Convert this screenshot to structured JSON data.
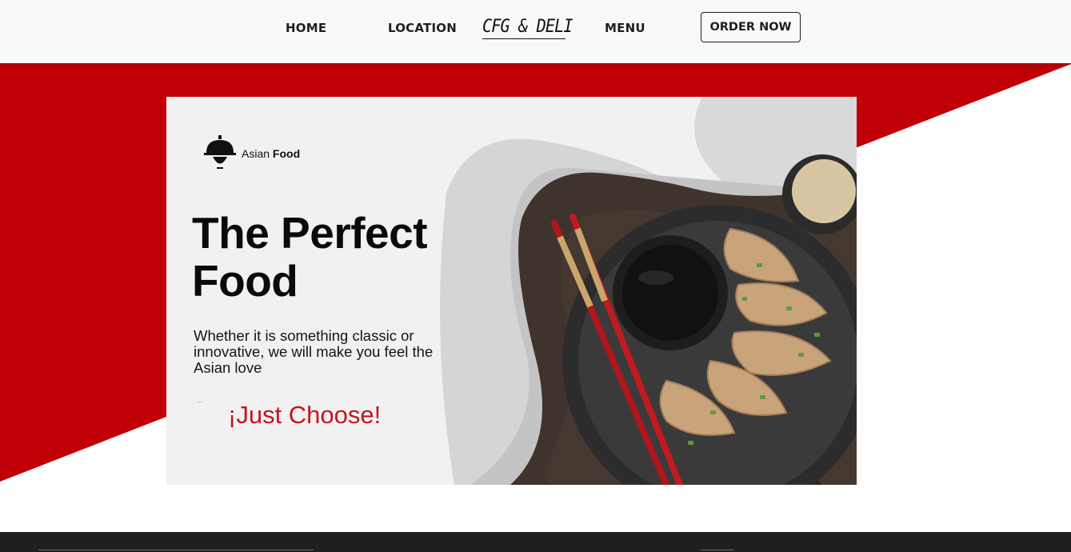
{
  "nav": {
    "home": "HOME",
    "location": "LOCATION",
    "brand": "CFG & DELI",
    "menu": "MENU",
    "order": "ORDER NOW"
  },
  "banner": {
    "brand_light": "Asian ",
    "brand_bold": "Food",
    "headline": "The Perfect Food",
    "subtext": "Whether it is something classic or innovative, we will make you feel the Asian love",
    "dots": "...",
    "cta": "¡Just Choose!"
  },
  "colors": {
    "accent_red": "#c00006",
    "cta_red": "#c4151c",
    "navbar_bg": "#f8f9fa",
    "footer_bg": "#1f1f1f",
    "banner_bg": "#f1f1f1"
  },
  "icons": {
    "logo": "cloche-icon"
  }
}
